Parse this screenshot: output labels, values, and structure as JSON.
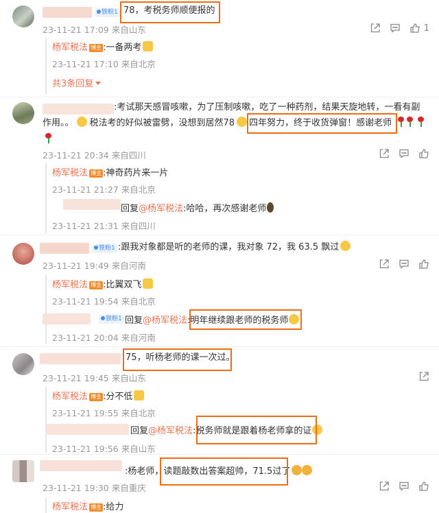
{
  "icons": {
    "share": "share-icon",
    "comment": "comment-icon",
    "like": "thumbs-up-icon"
  },
  "colors": {
    "name": "#eb7350",
    "highlight": "#ef6b14",
    "meta": "#999999",
    "badge": "#4b8ee9"
  },
  "blogger_name": "杨军税法",
  "blogger_badge": "博主",
  "fan_badge": "铁粉1",
  "reply_prefix": "回复",
  "mention": "@杨军税法",
  "comments": [
    {
      "text": "78，考税务师顺便报的",
      "meta": "23-11-21 17:09 来自山东",
      "likes": "1",
      "replies": [
        {
          "text": ":一备两考",
          "meta": "23-11-21 17:10 来自北京"
        }
      ],
      "more": "共3条回复"
    },
    {
      "text_line1": ":考试那天感冒咳嗽，为了压制咳嗽，吃了一种药剂，结果天旋地转，一看有副",
      "text_line2a": "作用。。",
      "text_line2b": "税法考的好似被雷劈，没想到居然78",
      "text_line2c": "四年努力，终于收货弹窗！感谢老师",
      "meta": "23-11-21 20:34 来自四川",
      "replies": [
        {
          "text": ":神奇药片来一片",
          "meta": "23-11-21 21:27 来自北京"
        },
        {
          "text": ":哈哈，再次感谢老师",
          "meta": "23-11-21 21:31 来自四川"
        }
      ]
    },
    {
      "text": ":跟我对象都是听的老师的课，我对象 72，我 63.5 飘过",
      "meta": "23-11-21 19:49 来自河南",
      "replies": [
        {
          "text": ":比翼双飞",
          "meta": "23-11-21 19:54 来自北京"
        },
        {
          "text": ":明年继续跟老师的税务师",
          "meta": "23-11-21 20:04 来自河南"
        }
      ]
    },
    {
      "text": "75，听杨老师的课一次过。",
      "meta": "23-11-21 19:45 来自山东",
      "replies": [
        {
          "text": ":分不低",
          "meta": "23-11-21 19:55 来自北京"
        },
        {
          "text": ":税务师就是跟着杨老师拿的证",
          "meta": "23-11-21 19:56 来自山东"
        }
      ]
    },
    {
      "text": ":杨老师，读题敲数出答案超帅，71.5过了",
      "meta": "23-11-21 19:30 来自重庆",
      "replies": [
        {
          "text": ":给力"
        }
      ]
    }
  ]
}
